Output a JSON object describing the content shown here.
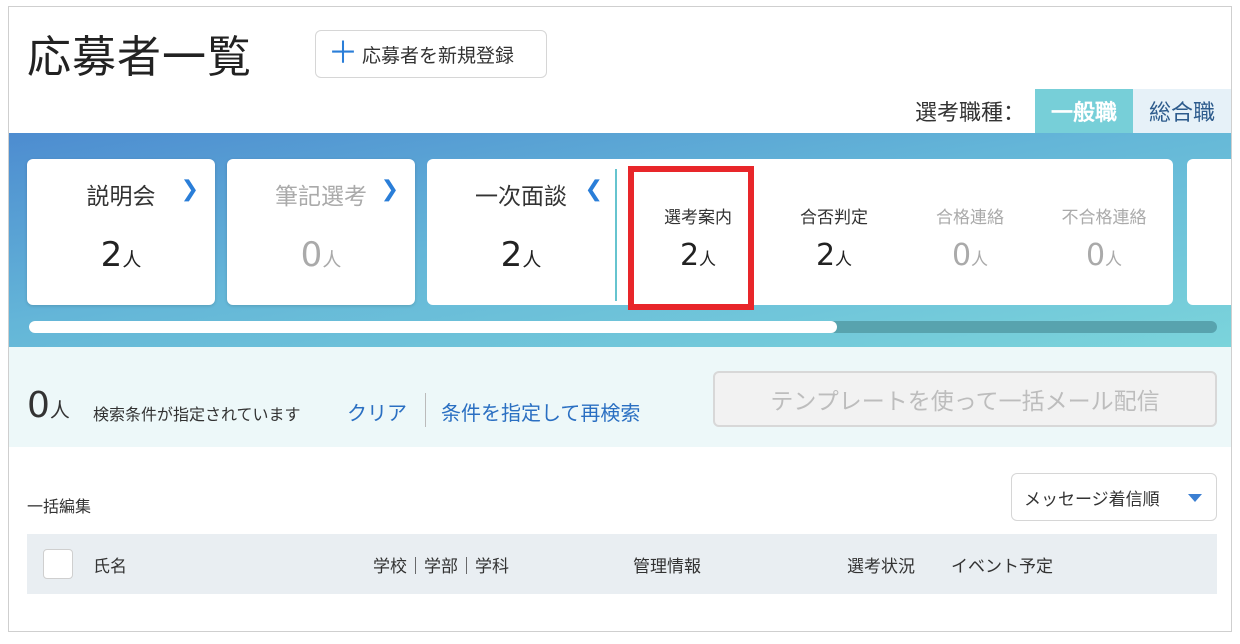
{
  "header": {
    "title": "応募者一覧",
    "register_label": "応募者を新規登録"
  },
  "job_type": {
    "label": "選考職種：",
    "tabs": [
      "一般職",
      "総合職"
    ],
    "active": "一般職"
  },
  "unit": "人",
  "stages": [
    {
      "name": "説明会",
      "count": "2"
    },
    {
      "name": "筆記選考",
      "count": "0"
    },
    {
      "name": "一次面談",
      "count": "2"
    }
  ],
  "sub_stages": [
    {
      "name": "選考案内",
      "count": "2"
    },
    {
      "name": "合否判定",
      "count": "2"
    },
    {
      "name": "合格連絡",
      "count": "0"
    },
    {
      "name": "不合格連絡",
      "count": "0"
    }
  ],
  "search_result": {
    "count": "0",
    "status_text": "検索条件が指定されています",
    "clear_label": "クリア",
    "research_label": "条件を指定して再検索",
    "mail_button_label": "テンプレートを使って一括メール配信"
  },
  "list": {
    "bulk_edit_label": "一括編集",
    "sort_label": "メッセージ着信順",
    "columns": [
      "氏名",
      "学校｜学部｜学科",
      "管理情報",
      "選考状況",
      "イベント予定"
    ]
  },
  "colors": {
    "accent": "#2a7ed8",
    "highlight": "#e8262a",
    "tab_active": "#77cfd8"
  }
}
